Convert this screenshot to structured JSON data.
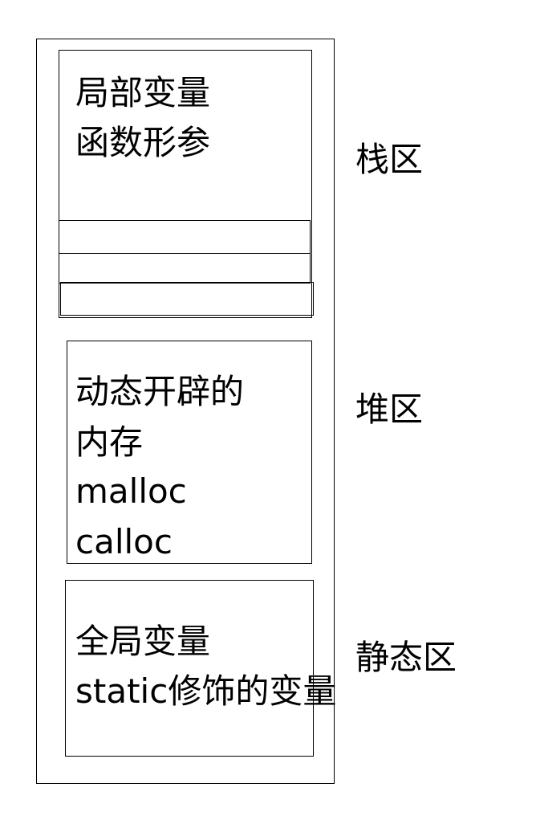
{
  "stack": {
    "label": "栈区",
    "lines": [
      "局部变量",
      "函数形参"
    ]
  },
  "heap": {
    "label": "堆区",
    "lines": [
      "动态开辟的",
      "内存",
      "malloc",
      "calloc"
    ]
  },
  "static": {
    "label": "静态区",
    "lines": [
      "全局变量",
      "static修饰的变量"
    ]
  }
}
